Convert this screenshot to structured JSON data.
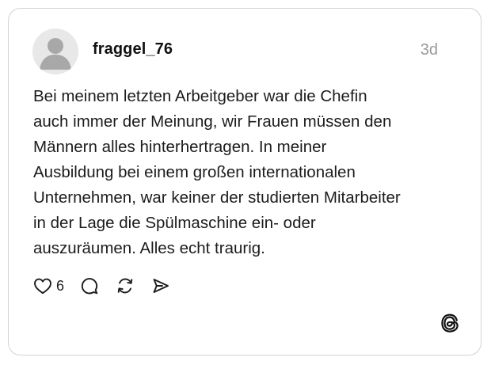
{
  "post": {
    "username": "fraggel_76",
    "timestamp": "3d",
    "text": "Bei meinem letzten Arbeitgeber war die Chefin\nauch immer der Meinung, wir Frauen müssen den\nMännern alles hinterhertragen. In meiner\nAusbildung bei einem großen internationalen\nUnternehmen, war keiner der studierten Mitarbeiter\nin der Lage die Spülmaschine ein- oder\nauszuräumen.  Alles echt traurig."
  },
  "actions": {
    "like_icon": "heart-icon",
    "like_count": "6",
    "comment_icon": "comment-icon",
    "repost_icon": "repost-icon",
    "share_icon": "send-icon"
  },
  "branding": {
    "logo_icon": "threads-logo-icon"
  },
  "colors": {
    "text": "#1c1c1c",
    "muted": "#999999",
    "border": "#d3d3d3",
    "avatar_bg": "#e8e8e8",
    "avatar_figure": "#a8a8a8"
  }
}
